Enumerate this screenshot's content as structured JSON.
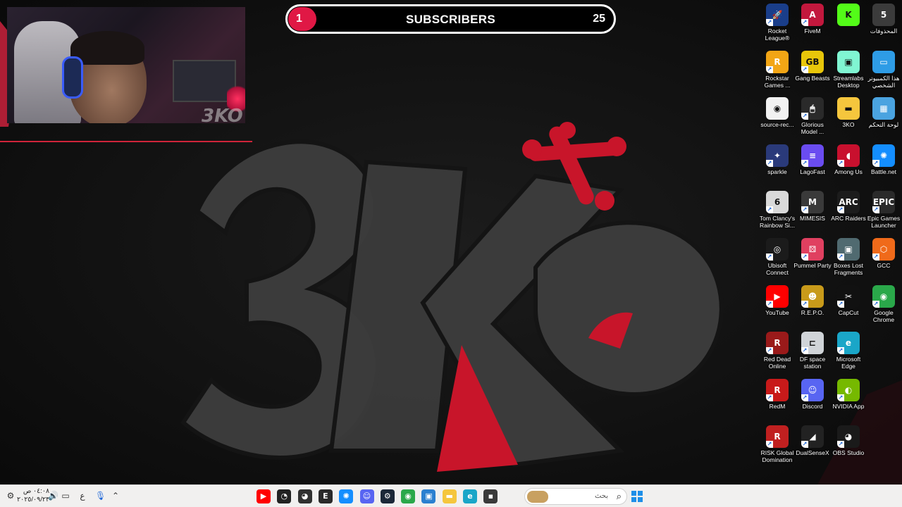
{
  "overlay": {
    "webcam_logo": "3KO",
    "subscribers": {
      "label": "SUBSCRIBERS",
      "current": "1",
      "goal": "25",
      "progress": 0.04
    }
  },
  "wallpaper": {
    "logo_text": "3KO",
    "accent": "#c8152a",
    "shape_color": "#3d3d3d"
  },
  "desktop_icons": [
    {
      "label": "Rocket League®",
      "icon": "rocket-league-icon",
      "bg": "#1a3e8a",
      "glyph": "🚀",
      "shortcut": true
    },
    {
      "label": "FiveM",
      "icon": "fivem-icon",
      "bg": "#c2183d",
      "glyph": "A",
      "shortcut": true
    },
    {
      "label": "",
      "icon": "kick-icon",
      "bg": "#53fc18",
      "glyph": "K",
      "shortcut": false
    },
    {
      "label": "المحذوفات",
      "icon": "recycle-bin-icon",
      "bg": "#3b3b3b",
      "glyph": "5",
      "shortcut": false
    },
    {
      "label": "Rockstar Games ...",
      "icon": "rockstar-icon",
      "bg": "#f2a515",
      "glyph": "R",
      "shortcut": true
    },
    {
      "label": "Gang Beasts",
      "icon": "gang-beasts-icon",
      "bg": "#e8c60a",
      "glyph": "GB",
      "shortcut": true
    },
    {
      "label": "Streamlabs Desktop",
      "icon": "streamlabs-icon",
      "bg": "#80f5d2",
      "glyph": "▣",
      "shortcut": false
    },
    {
      "label": "هذا الكمبيوتر الشخصي",
      "icon": "this-pc-icon",
      "bg": "#2e9ce6",
      "glyph": "▭",
      "shortcut": false
    },
    {
      "label": "source-rec...",
      "icon": "source-record-icon",
      "bg": "#f2f2f2",
      "glyph": "◉",
      "shortcut": false
    },
    {
      "label": "Glorious Model ...",
      "icon": "glorious-mouse-icon",
      "bg": "#2a2a2a",
      "glyph": "🖱",
      "shortcut": true
    },
    {
      "label": "3KO",
      "icon": "folder-icon",
      "bg": "#f5c63d",
      "glyph": "▬",
      "shortcut": false
    },
    {
      "label": "لوحة التحكم",
      "icon": "control-panel-icon",
      "bg": "#4aa3e0",
      "glyph": "▦",
      "shortcut": false
    },
    {
      "label": "sparkle",
      "icon": "sparkle-icon",
      "bg": "#2a3a7a",
      "glyph": "✦",
      "shortcut": true
    },
    {
      "label": "LagoFast",
      "icon": "lagofast-icon",
      "bg": "#6a4cf0",
      "glyph": "≡",
      "shortcut": true
    },
    {
      "label": "Among Us",
      "icon": "among-us-icon",
      "bg": "#c8102e",
      "glyph": "◖",
      "shortcut": true
    },
    {
      "label": "Battle.net",
      "icon": "battlenet-icon",
      "bg": "#148eff",
      "glyph": "✺",
      "shortcut": true
    },
    {
      "label": "Tom Clancy's Rainbow Si...",
      "icon": "rainbow-six-icon",
      "bg": "#d9d9d9",
      "glyph": "6",
      "shortcut": true
    },
    {
      "label": "MIMESIS",
      "icon": "mimesis-icon",
      "bg": "#3a3a3a",
      "glyph": "M",
      "shortcut": true
    },
    {
      "label": "ARC Raiders",
      "icon": "arc-raiders-icon",
      "bg": "#1c1c1c",
      "glyph": "ARC",
      "shortcut": true
    },
    {
      "label": "Epic Games Launcher",
      "icon": "epic-games-icon",
      "bg": "#2a2a2a",
      "glyph": "EPIC",
      "shortcut": true
    },
    {
      "label": "Ubisoft Connect",
      "icon": "ubisoft-icon",
      "bg": "#1b1b1b",
      "glyph": "◎",
      "shortcut": true
    },
    {
      "label": "Pummel Party",
      "icon": "pummel-party-icon",
      "bg": "#e04060",
      "glyph": "⚄",
      "shortcut": true
    },
    {
      "label": "Boxes Lost Fragments",
      "icon": "boxes-icon",
      "bg": "#506a70",
      "glyph": "▣",
      "shortcut": true
    },
    {
      "label": "GCC",
      "icon": "gcc-icon",
      "bg": "#f06a1a",
      "glyph": "⬡",
      "shortcut": true
    },
    {
      "label": "YouTube",
      "icon": "youtube-icon",
      "bg": "#ff0000",
      "glyph": "▶",
      "shortcut": true
    },
    {
      "label": "R.E.P.O.",
      "icon": "repo-icon",
      "bg": "#c89a1a",
      "glyph": "☻",
      "shortcut": true
    },
    {
      "label": "CapCut",
      "icon": "capcut-icon",
      "bg": "#111111",
      "glyph": "✂",
      "shortcut": true
    },
    {
      "label": "Google Chrome",
      "icon": "chrome-icon",
      "bg": "#2aa84a",
      "glyph": "◉",
      "shortcut": true
    },
    {
      "label": "Red Dead Online",
      "icon": "red-dead-online-icon",
      "bg": "#9a1a1a",
      "glyph": "R",
      "shortcut": true
    },
    {
      "label": "DF space station",
      "icon": "df-space-station-icon",
      "bg": "#d0d4d8",
      "glyph": "⊏",
      "shortcut": true
    },
    {
      "label": "Microsoft Edge",
      "icon": "edge-icon",
      "bg": "#1aa6c8",
      "glyph": "e",
      "shortcut": true
    },
    {
      "label": "",
      "icon": "empty-slot",
      "bg": "transparent",
      "glyph": "",
      "shortcut": false
    },
    {
      "label": "RedM",
      "icon": "redm-icon",
      "bg": "#c81a1a",
      "glyph": "R",
      "shortcut": true
    },
    {
      "label": "Discord",
      "icon": "discord-icon",
      "bg": "#5865f2",
      "glyph": "☺",
      "shortcut": true
    },
    {
      "label": "NVIDIA App",
      "icon": "nvidia-icon",
      "bg": "#76b900",
      "glyph": "◐",
      "shortcut": true
    },
    {
      "label": "",
      "icon": "empty-slot",
      "bg": "transparent",
      "glyph": "",
      "shortcut": false
    },
    {
      "label": "RISK Global Domination",
      "icon": "risk-icon",
      "bg": "#c02020",
      "glyph": "R",
      "shortcut": true
    },
    {
      "label": "DualSenseX",
      "icon": "dualsensex-icon",
      "bg": "#222222",
      "glyph": "◢",
      "shortcut": true
    },
    {
      "label": "OBS Studio",
      "icon": "obs-icon",
      "bg": "#1a1a1a",
      "glyph": "◕",
      "shortcut": true
    }
  ],
  "taskbar": {
    "clock_time": "٠٤:٠٨ ص",
    "clock_date": "٢٠٢٥/٠٩/٢٣",
    "lang": "ع",
    "search_placeholder": "بحث",
    "apps": [
      {
        "icon": "youtube-taskbar-icon",
        "bg": "#ff0000",
        "glyph": "▶"
      },
      {
        "icon": "speedometer-taskbar-icon",
        "bg": "#222222",
        "glyph": "◔"
      },
      {
        "icon": "obs-taskbar-icon",
        "bg": "#303030",
        "glyph": "◕"
      },
      {
        "icon": "epic-taskbar-icon",
        "bg": "#2a2a2a",
        "glyph": "E"
      },
      {
        "icon": "battlenet-taskbar-icon",
        "bg": "#148eff",
        "glyph": "✺"
      },
      {
        "icon": "discord-taskbar-icon",
        "bg": "#5865f2",
        "glyph": "☺"
      },
      {
        "icon": "steam-taskbar-icon",
        "bg": "#1b2838",
        "glyph": "⚙"
      },
      {
        "icon": "chrome-taskbar-icon",
        "bg": "#2aa84a",
        "glyph": "◉"
      },
      {
        "icon": "photos-taskbar-icon",
        "bg": "#2a80d0",
        "glyph": "▣"
      },
      {
        "icon": "file-explorer-taskbar-icon",
        "bg": "#f5c63d",
        "glyph": "▬"
      },
      {
        "icon": "edge-taskbar-icon",
        "bg": "#1aa6c8",
        "glyph": "e"
      },
      {
        "icon": "app-window-taskbar-icon",
        "bg": "#3a3a3a",
        "glyph": "▪"
      }
    ]
  }
}
